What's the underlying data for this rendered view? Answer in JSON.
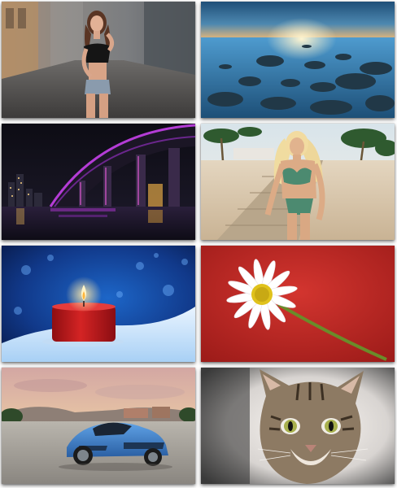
{
  "gallery": {
    "tiles": [
      {
        "subject": "woman-street"
      },
      {
        "subject": "sea-rocks-sunset"
      },
      {
        "subject": "night-bridge"
      },
      {
        "subject": "woman-beach"
      },
      {
        "subject": "red-candle"
      },
      {
        "subject": "daisy-on-red"
      },
      {
        "subject": "blue-sports-car"
      },
      {
        "subject": "tabby-cat"
      }
    ]
  },
  "colors": {
    "background": "#ffffff",
    "candle_red": "#c81e1e",
    "car_blue": "#3f82cf",
    "daisy_red": "#c22a26",
    "bridge_neon": "#b43cd6"
  }
}
